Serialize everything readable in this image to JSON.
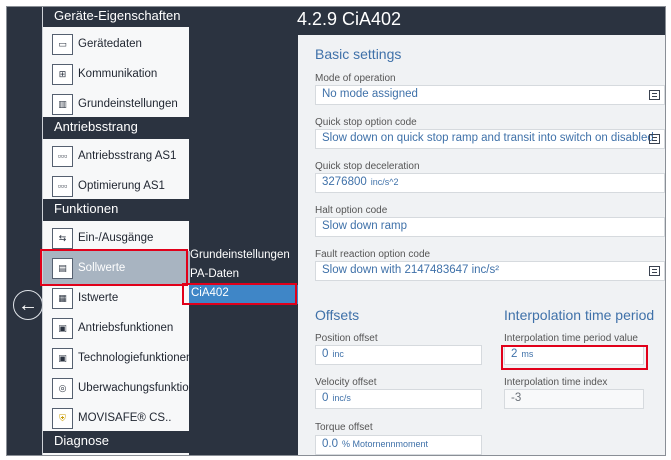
{
  "sidebar": {
    "categories": [
      "Geräte-Eigenschaften",
      "Antriebsstrang",
      "Funktionen",
      "Diagnose"
    ],
    "items": [
      {
        "label": "Gerätedaten",
        "icon": "▭"
      },
      {
        "label": "Kommunikation",
        "icon": "⊞"
      },
      {
        "label": "Grundeinstellungen",
        "icon": "▥"
      },
      {
        "label": "Antriebsstrang AS1",
        "icon": "▫▫▫"
      },
      {
        "label": "Optimierung AS1",
        "icon": "▫▫▫"
      },
      {
        "label": "Ein-/Ausgänge",
        "icon": "⇆"
      },
      {
        "label": "Sollwerte",
        "icon": "▤"
      },
      {
        "label": "Istwerte",
        "icon": "▦"
      },
      {
        "label": "Antriebsfunktionen",
        "icon": "▣"
      },
      {
        "label": "Technologiefunktionen",
        "icon": "▣"
      },
      {
        "label": "Überwachungsfunktionen",
        "icon": "◎"
      },
      {
        "label": "MOVISAFE® CS..",
        "icon": "⛨"
      }
    ]
  },
  "subnav": [
    "Grundeinstellungen",
    "PA-Daten",
    "CiA402"
  ],
  "page": {
    "title": "4.2.9 CiA402",
    "basic_heading": "Basic settings",
    "mode_label": "Mode of operation",
    "mode_value": "No mode assigned",
    "qs_option_label": "Quick stop option code",
    "qs_option_value": "Slow down on quick stop ramp and transit into switch on disabled",
    "qs_decel_label": "Quick stop deceleration",
    "qs_decel_value": "3276800",
    "qs_decel_unit": "inc/s^2",
    "halt_label": "Halt option code",
    "halt_value": "Slow down ramp",
    "fault_label": "Fault reaction option code",
    "fault_value": "Slow down with 2147483647 inc/s²",
    "offsets_heading": "Offsets",
    "pos_label": "Position offset",
    "pos_value": "0",
    "pos_unit": "inc",
    "vel_label": "Velocity offset",
    "vel_value": "0",
    "vel_unit": "inc/s",
    "torque_label": "Torque offset",
    "torque_value": "0.0",
    "torque_unit": "% Motornennmoment",
    "interp_heading": "Interpolation time period",
    "interp_val_label": "Interpolation time period value",
    "interp_val_value": "2",
    "interp_val_unit": "ms",
    "interp_idx_label": "Interpolation time index",
    "interp_idx_value": "-3"
  },
  "colors": {
    "accent": "#3f71a9",
    "highlight": "#e1001a",
    "nav_active": "#3f86c7",
    "dark_bg": "#2b3340"
  }
}
